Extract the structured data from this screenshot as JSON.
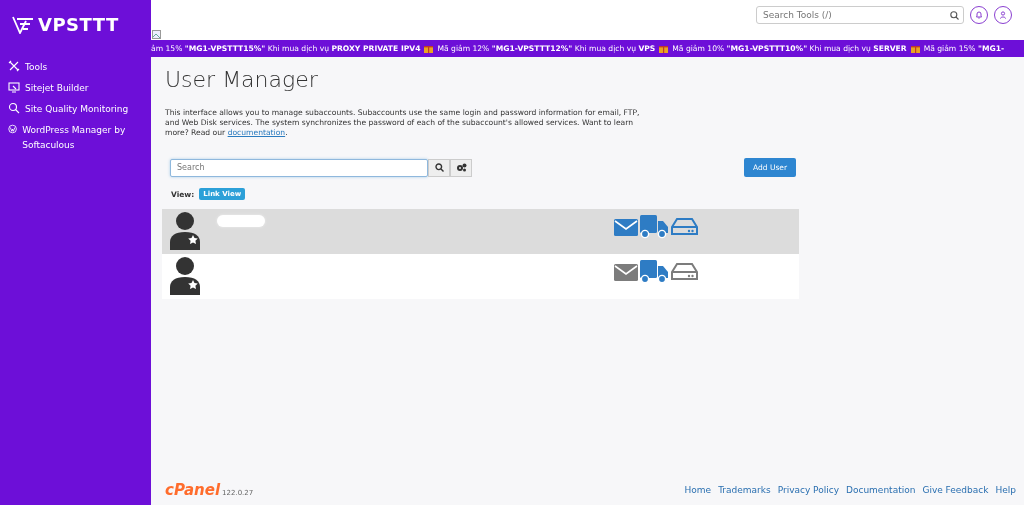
{
  "sidebar": {
    "brand": "VPSTTT",
    "items": [
      {
        "label": "Tools"
      },
      {
        "label": "Sitejet Builder"
      },
      {
        "label": "Site Quality Monitoring"
      },
      {
        "label": "WordPress Manager by Softaculous"
      }
    ]
  },
  "topbar": {
    "search": {
      "placeholder": "Search Tools (/)"
    }
  },
  "promo_banner": {
    "segments": [
      "ảm 15% **\"MG1-VPSTTT15%\"** Khi mua dịch vụ **PROXY PRIVATE IPV4**",
      "Mã giảm 12% **\"MG1-VPSTTT12%\"** Khi mua dịch vụ **VPS**",
      "Mã giảm 10% **\"MG1-VPSTTT10%\"** Khi mua dịch vụ **SERVER**",
      "Mã giảm 15% **\"MG1-**"
    ]
  },
  "page": {
    "title": "User Manager",
    "description": "This interface allows you to manage subaccounts. Subaccounts use the same login and password information for email, FTP, and Web Disk services. The system synchronizes the password of each of the subaccount's allowed services. Want to learn more? Read our",
    "description_link": "documentation",
    "description_end": "."
  },
  "toolbar": {
    "search": {
      "placeholder": "Search"
    },
    "add_button": "Add User",
    "view_label": "View:",
    "view_button": "Link View"
  },
  "users": [
    {
      "selected": true,
      "name_hidden": true,
      "email": true,
      "ftp": true,
      "webdisk": true
    },
    {
      "selected": false,
      "name_hidden": false,
      "email": false,
      "ftp": true,
      "webdisk": false
    }
  ],
  "footer": {
    "logo": "cPanel",
    "version": "122.0.27",
    "links": [
      "Home",
      "Trademarks",
      "Privacy Policy",
      "Documentation",
      "Give Feedback",
      "Help"
    ]
  }
}
